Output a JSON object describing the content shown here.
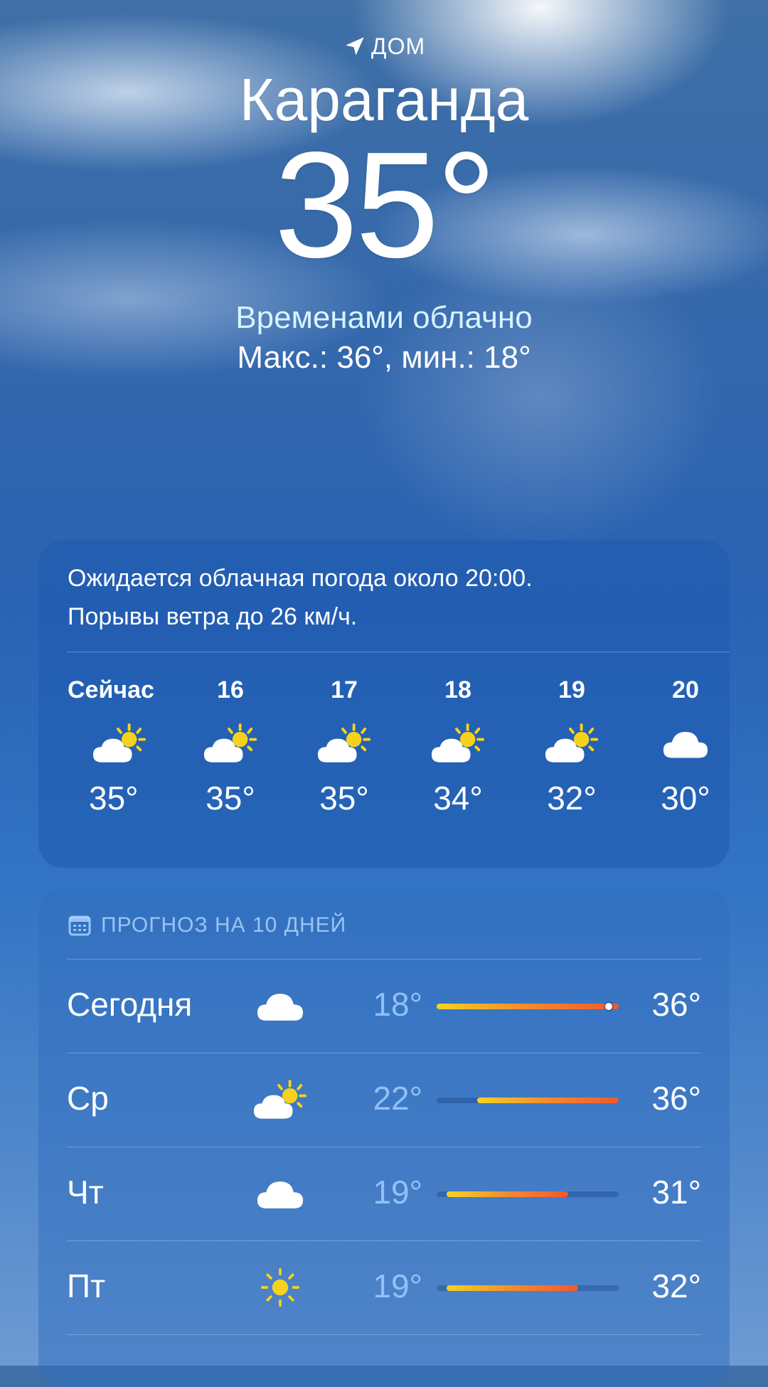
{
  "location": {
    "label": "ДОМ",
    "city": "Караганда"
  },
  "current": {
    "temperature": "35°",
    "condition": "Временами облачно",
    "hi_lo": "Макс.: 36°, мин.: 18°"
  },
  "hourly": {
    "summary_line1": "Ожидается облачная погода около 20:00.",
    "summary_line2": "Порывы ветра до 26 км/ч.",
    "items": [
      {
        "label": "Сейчас",
        "icon": "partly-sunny-icon",
        "temp": "35°"
      },
      {
        "label": "16",
        "icon": "partly-sunny-icon",
        "temp": "35°"
      },
      {
        "label": "17",
        "icon": "partly-sunny-icon",
        "temp": "35°"
      },
      {
        "label": "18",
        "icon": "partly-sunny-icon",
        "temp": "34°"
      },
      {
        "label": "19",
        "icon": "partly-sunny-icon",
        "temp": "32°"
      },
      {
        "label": "20",
        "icon": "cloud-icon",
        "temp": "30°"
      }
    ]
  },
  "daily": {
    "title": "ПРОГНОЗ НА 10 ДНЕЙ",
    "range_min": 18,
    "range_max": 36,
    "current_temp": 35,
    "days": [
      {
        "name": "Сегодня",
        "icon": "cloud-icon",
        "lo": "18°",
        "hi": "36°",
        "lo_val": 18,
        "hi_val": 36,
        "current": true
      },
      {
        "name": "Ср",
        "icon": "partly-sunny-icon",
        "lo": "22°",
        "hi": "36°",
        "lo_val": 22,
        "hi_val": 36
      },
      {
        "name": "Чт",
        "icon": "cloud-icon",
        "lo": "19°",
        "hi": "31°",
        "lo_val": 19,
        "hi_val": 31
      },
      {
        "name": "Пт",
        "icon": "sun-icon",
        "lo": "19°",
        "hi": "32°",
        "lo_val": 19,
        "hi_val": 32
      }
    ]
  },
  "colors": {
    "condition_text": "#d8f3ff",
    "sun": "#f6d21e",
    "bar_start": "#f5d321",
    "bar_end": "#f4582c"
  }
}
